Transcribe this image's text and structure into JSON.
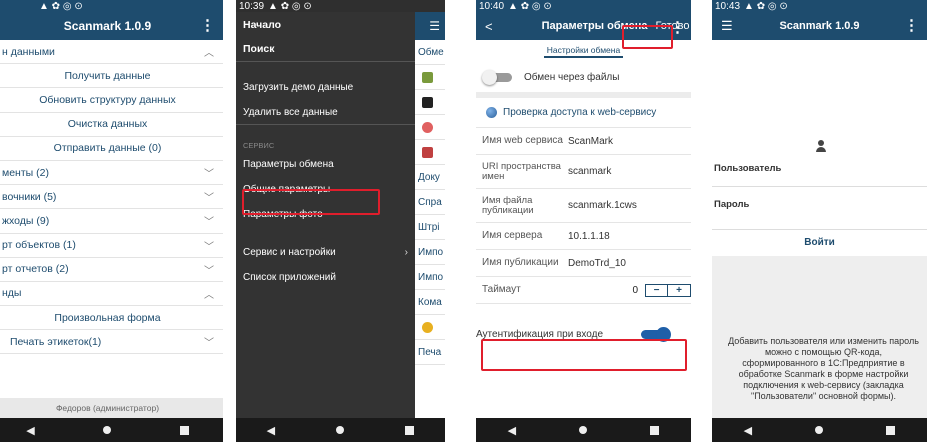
{
  "colors": {
    "primary": "#1e4c6e",
    "highlight": "#e01e2c",
    "drawer": "#333333",
    "toggle_on": "#1f5fa8"
  },
  "phone1": {
    "status_time": "",
    "status_icons": "▲ ✿ ◎ ⊙",
    "title": "Scanmark 1.0.9",
    "menu_icon": "kebab-vertical-icon",
    "rows": [
      {
        "label": "н данными",
        "type": "group",
        "chev": "up"
      },
      {
        "label": "Получить данные",
        "type": "action"
      },
      {
        "label": "Обновить структуру данных",
        "type": "action"
      },
      {
        "label": "Очистка данных",
        "type": "action"
      },
      {
        "label": "Отправить данные (0)",
        "type": "action"
      },
      {
        "label": "менты (2)",
        "type": "group",
        "chev": "down"
      },
      {
        "label": "вочники (5)",
        "type": "group",
        "chev": "down"
      },
      {
        "label": "жходы (9)",
        "type": "group",
        "chev": "down"
      },
      {
        "label": "рт объектов (1)",
        "type": "group",
        "chev": "down"
      },
      {
        "label": "рт отчетов (2)",
        "type": "group",
        "chev": "down"
      },
      {
        "label": "нды",
        "type": "group",
        "chev": "up"
      },
      {
        "label": "Произвольная форма",
        "type": "action"
      },
      {
        "label": "Печать этикеток(1)",
        "type": "group",
        "chev": "down"
      }
    ],
    "footer": "Федоров (администратор)"
  },
  "phone2": {
    "status_time": "10:39",
    "drawer_items": [
      {
        "label": "Начало",
        "bold": true
      },
      {
        "label": "Поиск",
        "bold": true
      },
      {
        "label": "",
        "bold": false
      },
      {
        "label": "Загрузить демо данные",
        "bold": false
      },
      {
        "label": "Удалить все данные",
        "bold": false
      },
      {
        "label": "",
        "bold": false
      }
    ],
    "section_label": "СЕРВИС",
    "service_items": [
      {
        "label": "Параметры обмена",
        "highlight": true
      },
      {
        "label": "Общие параметры"
      },
      {
        "label": "Параметры фото"
      },
      {
        "label": ""
      },
      {
        "label": "Сервис и настройки",
        "arrow": true
      },
      {
        "label": "Список приложений"
      }
    ],
    "main_items": [
      "Обме",
      "",
      "",
      "",
      "",
      "Доку",
      "Спра",
      "Штрі",
      "Импо",
      "Импо",
      "Кома",
      "",
      "Печа"
    ],
    "main_icons": [
      "",
      "box-arrow-icon",
      "barcode-icon",
      "cancel-icon",
      "exit-icon",
      "",
      "",
      "",
      "",
      "",
      "",
      "bulb-icon",
      ""
    ]
  },
  "phone3": {
    "status_time": "10:40",
    "title": "Параметры обмена",
    "done_label": "Готово",
    "tab_label": "Настройки обмена",
    "file_exchange_label": "Обмен через файлы",
    "file_exchange_on": false,
    "check_label": "Проверка доступа к web-сервису",
    "fields": [
      {
        "key": "Имя web сервиса",
        "value": "ScanMark"
      },
      {
        "key": "URI пространства имен",
        "value": "scanmark"
      },
      {
        "key": "Имя файла публикации",
        "value": "scanmark.1cws"
      },
      {
        "key": "Имя сервера",
        "value": "10.1.1.18"
      },
      {
        "key": "Имя публикации",
        "value": "DemoTrd_10"
      }
    ],
    "timeout_label": "Таймаут",
    "timeout_value": "0",
    "minus": "−",
    "plus": "+",
    "auth_label": "Аутентификация при входе",
    "auth_on": true
  },
  "phone4": {
    "status_time": "10:43",
    "title": "Scanmark 1.0.9",
    "user_label": "Пользователь",
    "password_label": "Пароль",
    "login_label": "Войти",
    "info_text": "Добавить пользователя или изменить пароль можно с помощью QR-кода, сформированного в 1С:Предприятие в обработке Scanmark в форме настройки подключения к web-сервису (закладка \"Пользователи\" основной формы)."
  }
}
